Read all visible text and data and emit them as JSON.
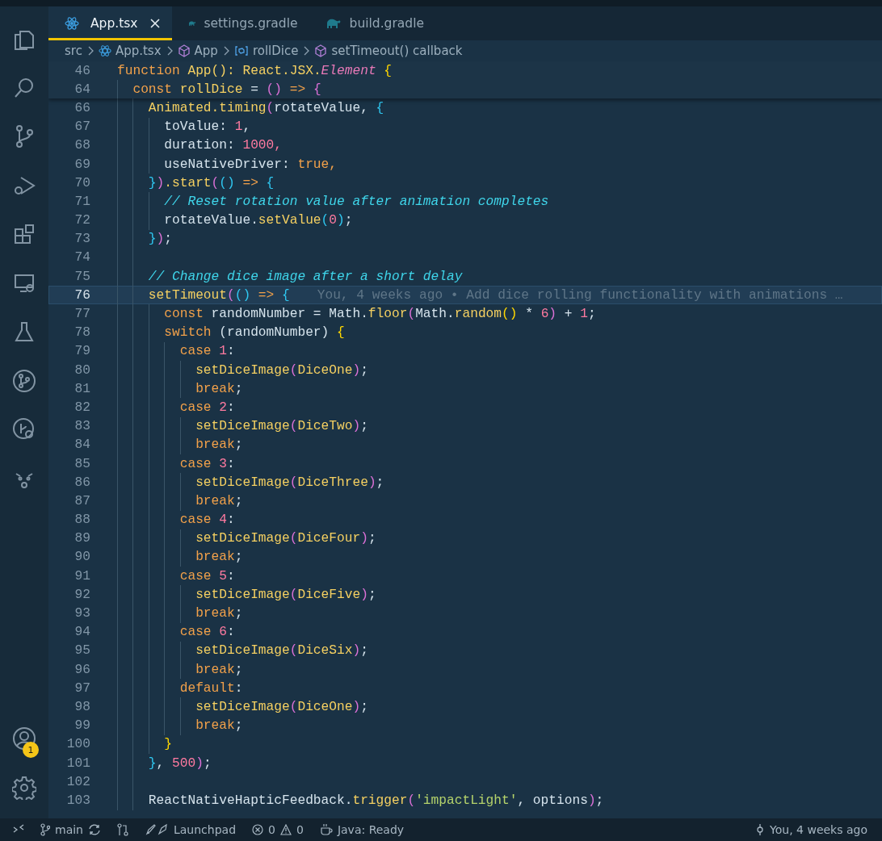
{
  "activity_bar": {
    "items": [
      {
        "kind": "files"
      },
      {
        "kind": "search"
      },
      {
        "kind": "branch"
      },
      {
        "kind": "debug"
      },
      {
        "kind": "extensions"
      },
      {
        "kind": "remote"
      },
      {
        "kind": "flask"
      },
      {
        "kind": "pull"
      },
      {
        "kind": "history"
      },
      {
        "kind": "face"
      }
    ],
    "account_badge": "1"
  },
  "tabs": [
    {
      "label": "App.tsx",
      "kind": "react",
      "selected": true
    },
    {
      "label": "settings.gradle",
      "kind": "gradle",
      "selected": false
    },
    {
      "label": "build.gradle",
      "kind": "gradle",
      "selected": false
    }
  ],
  "breadcrumbs": [
    {
      "label": "src",
      "kind": "folder"
    },
    {
      "label": "App.tsx",
      "kind": "react"
    },
    {
      "label": "App",
      "kind": "cube"
    },
    {
      "label": "rollDice",
      "kind": "variable"
    },
    {
      "label": "setTimeout() callback",
      "kind": "cube"
    }
  ],
  "sticky_lines": [
    {
      "number": "46",
      "tokens": [
        {
          "text": "function ",
          "color": "#f2a14a"
        },
        {
          "text": "App():",
          "color": "#f5d061"
        },
        {
          "text": " React.JSX.",
          "color": "#f5d061"
        },
        {
          "text": "Element",
          "color": "#e879b8",
          "italic": true
        },
        {
          "text": " {",
          "color": "#ffd700"
        }
      ]
    },
    {
      "number": "64",
      "tokens": [
        {
          "text": "  const",
          "color": "#f2a14a"
        },
        {
          "text": " rollDice",
          "color": "#f5d061"
        },
        {
          "text": " = ",
          "color": "#d5e3ec"
        },
        {
          "text": "()",
          "color": "#da70d6"
        },
        {
          "text": " => ",
          "color": "#f2a14a"
        },
        {
          "text": "{",
          "color": "#da70d6"
        }
      ]
    }
  ],
  "lines": [
    {
      "number": "66",
      "current": false,
      "tokens": [
        {
          "text": "    Animated.timing",
          "color": "#f5d061"
        },
        {
          "text": "(",
          "color": "#da70d6"
        },
        {
          "text": "rotateValue, ",
          "color": "#d5e3ec"
        },
        {
          "text": "{",
          "color": "#2fc7f0"
        }
      ]
    },
    {
      "number": "67",
      "current": false,
      "tokens": [
        {
          "text": "      toValue: ",
          "color": "#d5e3ec"
        },
        {
          "text": "1",
          "color": "#ff7aa0"
        },
        {
          "text": ",",
          "color": "#d5e3ec"
        }
      ]
    },
    {
      "number": "68",
      "current": false,
      "tokens": [
        {
          "text": "      duration: ",
          "color": "#d5e3ec"
        },
        {
          "text": "1000,",
          "color": "#ff7aa0"
        }
      ]
    },
    {
      "number": "69",
      "current": false,
      "tokens": [
        {
          "text": "      useNativeDriver: ",
          "color": "#d5e3ec"
        },
        {
          "text": "true,",
          "color": "#f2a14a"
        }
      ]
    },
    {
      "number": "70",
      "current": false,
      "tokens": [
        {
          "text": "    }",
          "color": "#2fc7f0"
        },
        {
          "text": ")",
          "color": "#da70d6"
        },
        {
          "text": ".start",
          "color": "#f5d061"
        },
        {
          "text": "(",
          "color": "#da70d6"
        },
        {
          "text": "()",
          "color": "#2fc7f0"
        },
        {
          "text": " => ",
          "color": "#f2a14a"
        },
        {
          "text": "{",
          "color": "#2fc7f0"
        }
      ]
    },
    {
      "number": "71",
      "current": false,
      "tokens": [
        {
          "text": "      // Reset rotation value after animation completes",
          "color": "#3fd5ea",
          "italic": true
        }
      ]
    },
    {
      "number": "72",
      "current": false,
      "tokens": [
        {
          "text": "      rotateValue.",
          "color": "#d5e3ec"
        },
        {
          "text": "setValue",
          "color": "#f5d061"
        },
        {
          "text": "(",
          "color": "#2fc7f0"
        },
        {
          "text": "0",
          "color": "#ff7aa0"
        },
        {
          "text": ")",
          "color": "#2fc7f0"
        },
        {
          "text": ";",
          "color": "#d5e3ec"
        }
      ]
    },
    {
      "number": "73",
      "current": false,
      "tokens": [
        {
          "text": "    }",
          "color": "#2fc7f0"
        },
        {
          "text": ")",
          "color": "#da70d6"
        },
        {
          "text": ";",
          "color": "#d5e3ec"
        }
      ]
    },
    {
      "number": "74",
      "current": false
    },
    {
      "number": "75",
      "current": false,
      "tokens": [
        {
          "text": "    // Change dice image after a short delay",
          "color": "#3fd5ea",
          "italic": true
        }
      ]
    },
    {
      "number": "76",
      "current": true,
      "tokens": [
        {
          "text": "    setTimeout",
          "color": "#f5d061"
        },
        {
          "text": "(",
          "color": "#da70d6"
        },
        {
          "text": "()",
          "color": "#2fc7f0"
        },
        {
          "text": " => ",
          "color": "#f2a14a"
        },
        {
          "text": "{",
          "color": "#2fc7f0"
        }
      ],
      "blame": "You, 4 weeks ago • Add dice rolling functionality with animations …"
    },
    {
      "number": "77",
      "current": false,
      "tokens": [
        {
          "text": "      const",
          "color": "#f2a14a"
        },
        {
          "text": " randomNumber = Math.",
          "color": "#d5e3ec"
        },
        {
          "text": "floor",
          "color": "#f5d061"
        },
        {
          "text": "(",
          "color": "#da70d6"
        },
        {
          "text": "Math.",
          "color": "#d5e3ec"
        },
        {
          "text": "random",
          "color": "#f5d061"
        },
        {
          "text": "()",
          "color": "#ffd700"
        },
        {
          "text": " * ",
          "color": "#d5e3ec"
        },
        {
          "text": "6",
          "color": "#ff7aa0"
        },
        {
          "text": ")",
          "color": "#da70d6"
        },
        {
          "text": " + ",
          "color": "#d5e3ec"
        },
        {
          "text": "1",
          "color": "#ff7aa0"
        },
        {
          "text": ";",
          "color": "#d5e3ec"
        }
      ]
    },
    {
      "number": "78",
      "current": false,
      "tokens": [
        {
          "text": "      switch",
          "color": "#f2a14a"
        },
        {
          "text": " (randomNumber) ",
          "color": "#d5e3ec"
        },
        {
          "text": "{",
          "color": "#ffd700"
        }
      ]
    },
    {
      "number": "79",
      "current": false,
      "tokens": [
        {
          "text": "        case ",
          "color": "#f2a14a"
        },
        {
          "text": "1",
          "color": "#ff7aa0"
        },
        {
          "text": ":",
          "color": "#d5e3ec"
        }
      ]
    },
    {
      "number": "80",
      "current": false,
      "tokens": [
        {
          "text": "          setDiceImage",
          "color": "#f5d061"
        },
        {
          "text": "(",
          "color": "#da70d6"
        },
        {
          "text": "DiceOne",
          "color": "#f5d061"
        },
        {
          "text": ")",
          "color": "#da70d6"
        },
        {
          "text": ";",
          "color": "#d5e3ec"
        }
      ]
    },
    {
      "number": "81",
      "current": false,
      "tokens": [
        {
          "text": "          break",
          "color": "#f2a14a"
        },
        {
          "text": ";",
          "color": "#d5e3ec"
        }
      ]
    },
    {
      "number": "82",
      "current": false,
      "tokens": [
        {
          "text": "        case ",
          "color": "#f2a14a"
        },
        {
          "text": "2",
          "color": "#ff7aa0"
        },
        {
          "text": ":",
          "color": "#d5e3ec"
        }
      ]
    },
    {
      "number": "83",
      "current": false,
      "tokens": [
        {
          "text": "          setDiceImage",
          "color": "#f5d061"
        },
        {
          "text": "(",
          "color": "#da70d6"
        },
        {
          "text": "DiceTwo",
          "color": "#f5d061"
        },
        {
          "text": ")",
          "color": "#da70d6"
        },
        {
          "text": ";",
          "color": "#d5e3ec"
        }
      ]
    },
    {
      "number": "84",
      "current": false,
      "tokens": [
        {
          "text": "          break",
          "color": "#f2a14a"
        },
        {
          "text": ";",
          "color": "#d5e3ec"
        }
      ]
    },
    {
      "number": "85",
      "current": false,
      "tokens": [
        {
          "text": "        case ",
          "color": "#f2a14a"
        },
        {
          "text": "3",
          "color": "#ff7aa0"
        },
        {
          "text": ":",
          "color": "#d5e3ec"
        }
      ]
    },
    {
      "number": "86",
      "current": false,
      "tokens": [
        {
          "text": "          setDiceImage",
          "color": "#f5d061"
        },
        {
          "text": "(",
          "color": "#da70d6"
        },
        {
          "text": "DiceThree",
          "color": "#f5d061"
        },
        {
          "text": ")",
          "color": "#da70d6"
        },
        {
          "text": ";",
          "color": "#d5e3ec"
        }
      ]
    },
    {
      "number": "87",
      "current": false,
      "tokens": [
        {
          "text": "          break",
          "color": "#f2a14a"
        },
        {
          "text": ";",
          "color": "#d5e3ec"
        }
      ]
    },
    {
      "number": "88",
      "current": false,
      "tokens": [
        {
          "text": "        case ",
          "color": "#f2a14a"
        },
        {
          "text": "4",
          "color": "#ff7aa0"
        },
        {
          "text": ":",
          "color": "#d5e3ec"
        }
      ]
    },
    {
      "number": "89",
      "current": false,
      "tokens": [
        {
          "text": "          setDiceImage",
          "color": "#f5d061"
        },
        {
          "text": "(",
          "color": "#da70d6"
        },
        {
          "text": "DiceFour",
          "color": "#f5d061"
        },
        {
          "text": ")",
          "color": "#da70d6"
        },
        {
          "text": ";",
          "color": "#d5e3ec"
        }
      ]
    },
    {
      "number": "90",
      "current": false,
      "tokens": [
        {
          "text": "          break",
          "color": "#f2a14a"
        },
        {
          "text": ";",
          "color": "#d5e3ec"
        }
      ]
    },
    {
      "number": "91",
      "current": false,
      "tokens": [
        {
          "text": "        case ",
          "color": "#f2a14a"
        },
        {
          "text": "5",
          "color": "#ff7aa0"
        },
        {
          "text": ":",
          "color": "#d5e3ec"
        }
      ]
    },
    {
      "number": "92",
      "current": false,
      "tokens": [
        {
          "text": "          setDiceImage",
          "color": "#f5d061"
        },
        {
          "text": "(",
          "color": "#da70d6"
        },
        {
          "text": "DiceFive",
          "color": "#f5d061"
        },
        {
          "text": ")",
          "color": "#da70d6"
        },
        {
          "text": ";",
          "color": "#d5e3ec"
        }
      ]
    },
    {
      "number": "93",
      "current": false,
      "tokens": [
        {
          "text": "          break",
          "color": "#f2a14a"
        },
        {
          "text": ";",
          "color": "#d5e3ec"
        }
      ]
    },
    {
      "number": "94",
      "current": false,
      "tokens": [
        {
          "text": "        case ",
          "color": "#f2a14a"
        },
        {
          "text": "6",
          "color": "#ff7aa0"
        },
        {
          "text": ":",
          "color": "#d5e3ec"
        }
      ]
    },
    {
      "number": "95",
      "current": false,
      "tokens": [
        {
          "text": "          setDiceImage",
          "color": "#f5d061"
        },
        {
          "text": "(",
          "color": "#da70d6"
        },
        {
          "text": "DiceSix",
          "color": "#f5d061"
        },
        {
          "text": ")",
          "color": "#da70d6"
        },
        {
          "text": ";",
          "color": "#d5e3ec"
        }
      ]
    },
    {
      "number": "96",
      "current": false,
      "tokens": [
        {
          "text": "          break",
          "color": "#f2a14a"
        },
        {
          "text": ";",
          "color": "#d5e3ec"
        }
      ]
    },
    {
      "number": "97",
      "current": false,
      "tokens": [
        {
          "text": "        default",
          "color": "#f2a14a"
        },
        {
          "text": ":",
          "color": "#d5e3ec"
        }
      ]
    },
    {
      "number": "98",
      "current": false,
      "tokens": [
        {
          "text": "          setDiceImage",
          "color": "#f5d061"
        },
        {
          "text": "(",
          "color": "#da70d6"
        },
        {
          "text": "DiceOne",
          "color": "#f5d061"
        },
        {
          "text": ")",
          "color": "#da70d6"
        },
        {
          "text": ";",
          "color": "#d5e3ec"
        }
      ]
    },
    {
      "number": "99",
      "current": false,
      "tokens": [
        {
          "text": "          break",
          "color": "#f2a14a"
        },
        {
          "text": ";",
          "color": "#d5e3ec"
        }
      ]
    },
    {
      "number": "100",
      "current": false,
      "tokens": [
        {
          "text": "      }",
          "color": "#ffd700"
        }
      ]
    },
    {
      "number": "101",
      "current": false,
      "tokens": [
        {
          "text": "    }",
          "color": "#2fc7f0"
        },
        {
          "text": ", ",
          "color": "#d5e3ec"
        },
        {
          "text": "500",
          "color": "#ff7aa0"
        },
        {
          "text": ")",
          "color": "#da70d6"
        },
        {
          "text": ";",
          "color": "#d5e3ec"
        }
      ]
    },
    {
      "number": "102",
      "current": false
    },
    {
      "number": "103",
      "current": false,
      "tokens": [
        {
          "text": "    ReactNativeHapticFeedback.",
          "color": "#d5e3ec"
        },
        {
          "text": "trigger",
          "color": "#f5d061"
        },
        {
          "text": "(",
          "color": "#da70d6"
        },
        {
          "text": "'impactLight'",
          "color": "#b5d36b"
        },
        {
          "text": ", options",
          "color": "#d5e3ec"
        },
        {
          "text": ")",
          "color": "#da70d6"
        },
        {
          "text": ";",
          "color": "#d5e3ec"
        }
      ]
    }
  ],
  "status_bar": {
    "branch": "main",
    "launchpad": "Launchpad",
    "errors": "0",
    "warnings": "0",
    "java": "Java: Ready",
    "blame": "You, 4 weeks ago"
  }
}
